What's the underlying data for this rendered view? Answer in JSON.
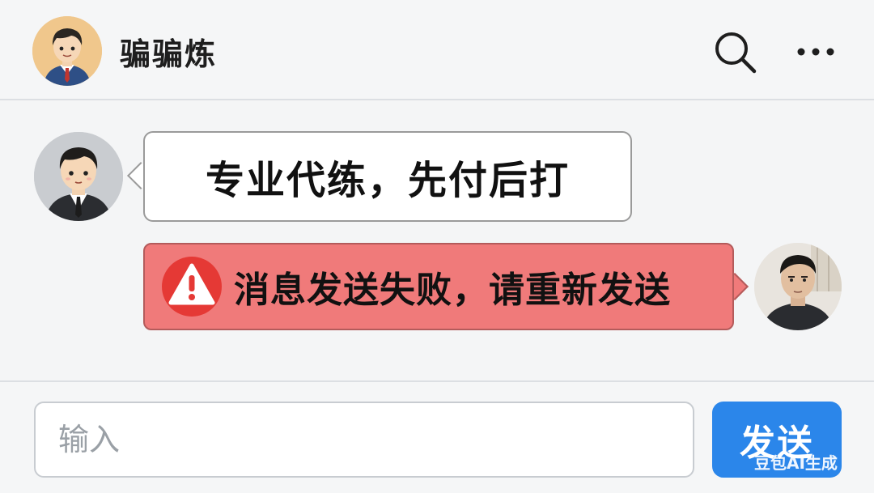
{
  "header": {
    "title": "骗骗炼",
    "icons": [
      "cartoon-boy-avatar",
      "search-icon",
      "more-icon"
    ]
  },
  "messages": [
    {
      "direction": "incoming",
      "avatar": "cartoon-suit-avatar",
      "text": "专业代练，先付后打"
    },
    {
      "direction": "outgoing",
      "avatar": "photo-avatar",
      "status": "failed",
      "status_icon": "warning-icon",
      "text": "消息发送失败，请重新发送"
    }
  ],
  "composer": {
    "placeholder": "输入",
    "send_label": "发送"
  },
  "watermark": "豆包AI生成",
  "colors": {
    "error_bubble": "#f07a7a",
    "send_button": "#2b86ea",
    "warning_icon": "#e53935"
  }
}
